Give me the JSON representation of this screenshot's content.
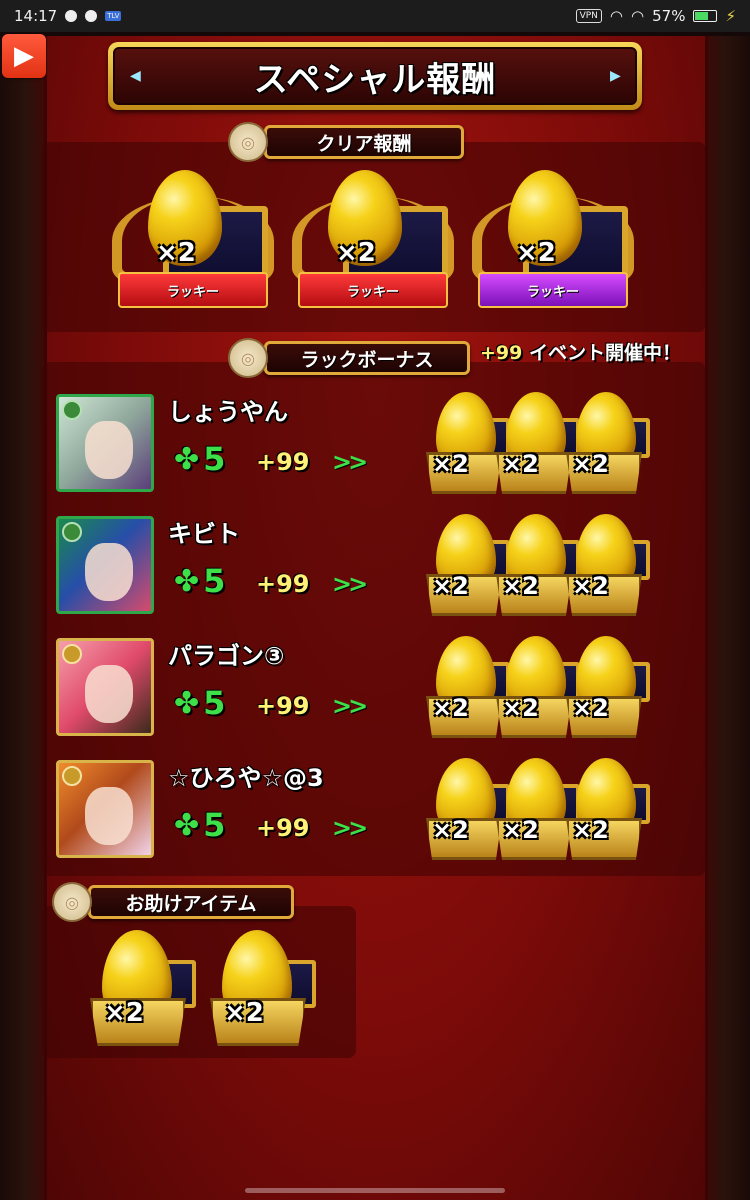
{
  "status": {
    "time": "14:17",
    "vpn": "VPN",
    "tlv": "TLV",
    "battery": "57%"
  },
  "title": "スペシャル報酬",
  "clear_reward": {
    "header": "クリア報酬",
    "items": [
      {
        "mult": "×2",
        "label": "ラッキー",
        "color": "red"
      },
      {
        "mult": "×2",
        "label": "ラッキー",
        "color": "red"
      },
      {
        "mult": "×2",
        "label": "ラッキー",
        "color": "purple"
      }
    ]
  },
  "luck_bonus": {
    "header": "ラックボーナス",
    "event_plus": "+99",
    "event_text": " イベント開催中！",
    "players": [
      {
        "name": "しょうやん",
        "luck": "5",
        "bonus": "+99",
        "arrow": ">>",
        "rewards": [
          "×2",
          "×2",
          "×2"
        ]
      },
      {
        "name": "キビト",
        "luck": "5",
        "bonus": "+99",
        "arrow": ">>",
        "rewards": [
          "×2",
          "×2",
          "×2"
        ]
      },
      {
        "name": "パラゴン③",
        "luck": "5",
        "bonus": "+99",
        "arrow": ">>",
        "rewards": [
          "×2",
          "×2",
          "×2"
        ]
      },
      {
        "name": "☆ひろや☆@3",
        "luck": "5",
        "bonus": "+99",
        "arrow": ">>",
        "rewards": [
          "×2",
          "×2",
          "×2"
        ]
      }
    ]
  },
  "help_items": {
    "header": "お助けアイテム",
    "rewards": [
      "×2",
      "×2"
    ]
  },
  "colors": {
    "panel_red": "#7c0b09",
    "gold": "#e0a93a",
    "luck_green": "#3ee04a",
    "bonus_yellow": "#fff176",
    "ribbon_red": "#d01a20",
    "ribbon_purple": "#a02ad8"
  },
  "icons": {
    "play": "play-icon",
    "clover": "clover-icon",
    "egg": "golden-egg-icon"
  }
}
